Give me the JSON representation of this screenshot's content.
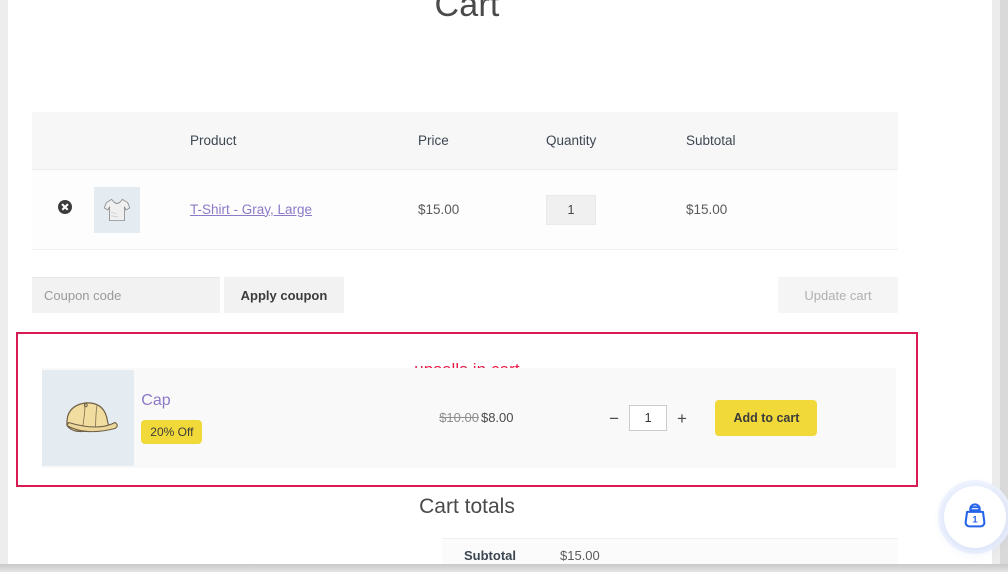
{
  "page": {
    "title": "Cart"
  },
  "cart_table": {
    "headers": {
      "remove": "",
      "thumb": "",
      "product": "Product",
      "price": "Price",
      "quantity": "Quantity",
      "subtotal": "Subtotal"
    },
    "rows": [
      {
        "remove_icon": "remove-item-icon",
        "thumb_icon": "tshirt-thumbnail",
        "product": "T-Shirt - Gray, Large",
        "price": "$15.00",
        "quantity": "1",
        "subtotal": "$15.00"
      }
    ]
  },
  "coupon": {
    "placeholder": "Coupon code",
    "value": "",
    "apply_label": "Apply coupon",
    "update_label": "Update cart"
  },
  "upsells": {
    "label": "upsells in cart",
    "items": [
      {
        "thumb_icon": "cap-thumbnail",
        "title": "Cap",
        "badge": "20% Off",
        "price_old": "$10.00",
        "price_new": "$8.00",
        "minus_label": "−",
        "plus_label": "+",
        "quantity": "1",
        "add_label": "Add to cart"
      }
    ]
  },
  "cart_totals": {
    "title": "Cart totals",
    "rows": [
      {
        "label": "Subtotal",
        "value": "$15.00"
      }
    ]
  },
  "floating_cart": {
    "icon": "shopping-bag-icon",
    "count": "1"
  },
  "colors": {
    "accent_upsell_border": "#d81b52",
    "accent_upsell_text": "#e81b47",
    "brand_yellow": "#f2d93a",
    "link_purple": "#8d79c6",
    "cart_blue": "#2563eb"
  }
}
